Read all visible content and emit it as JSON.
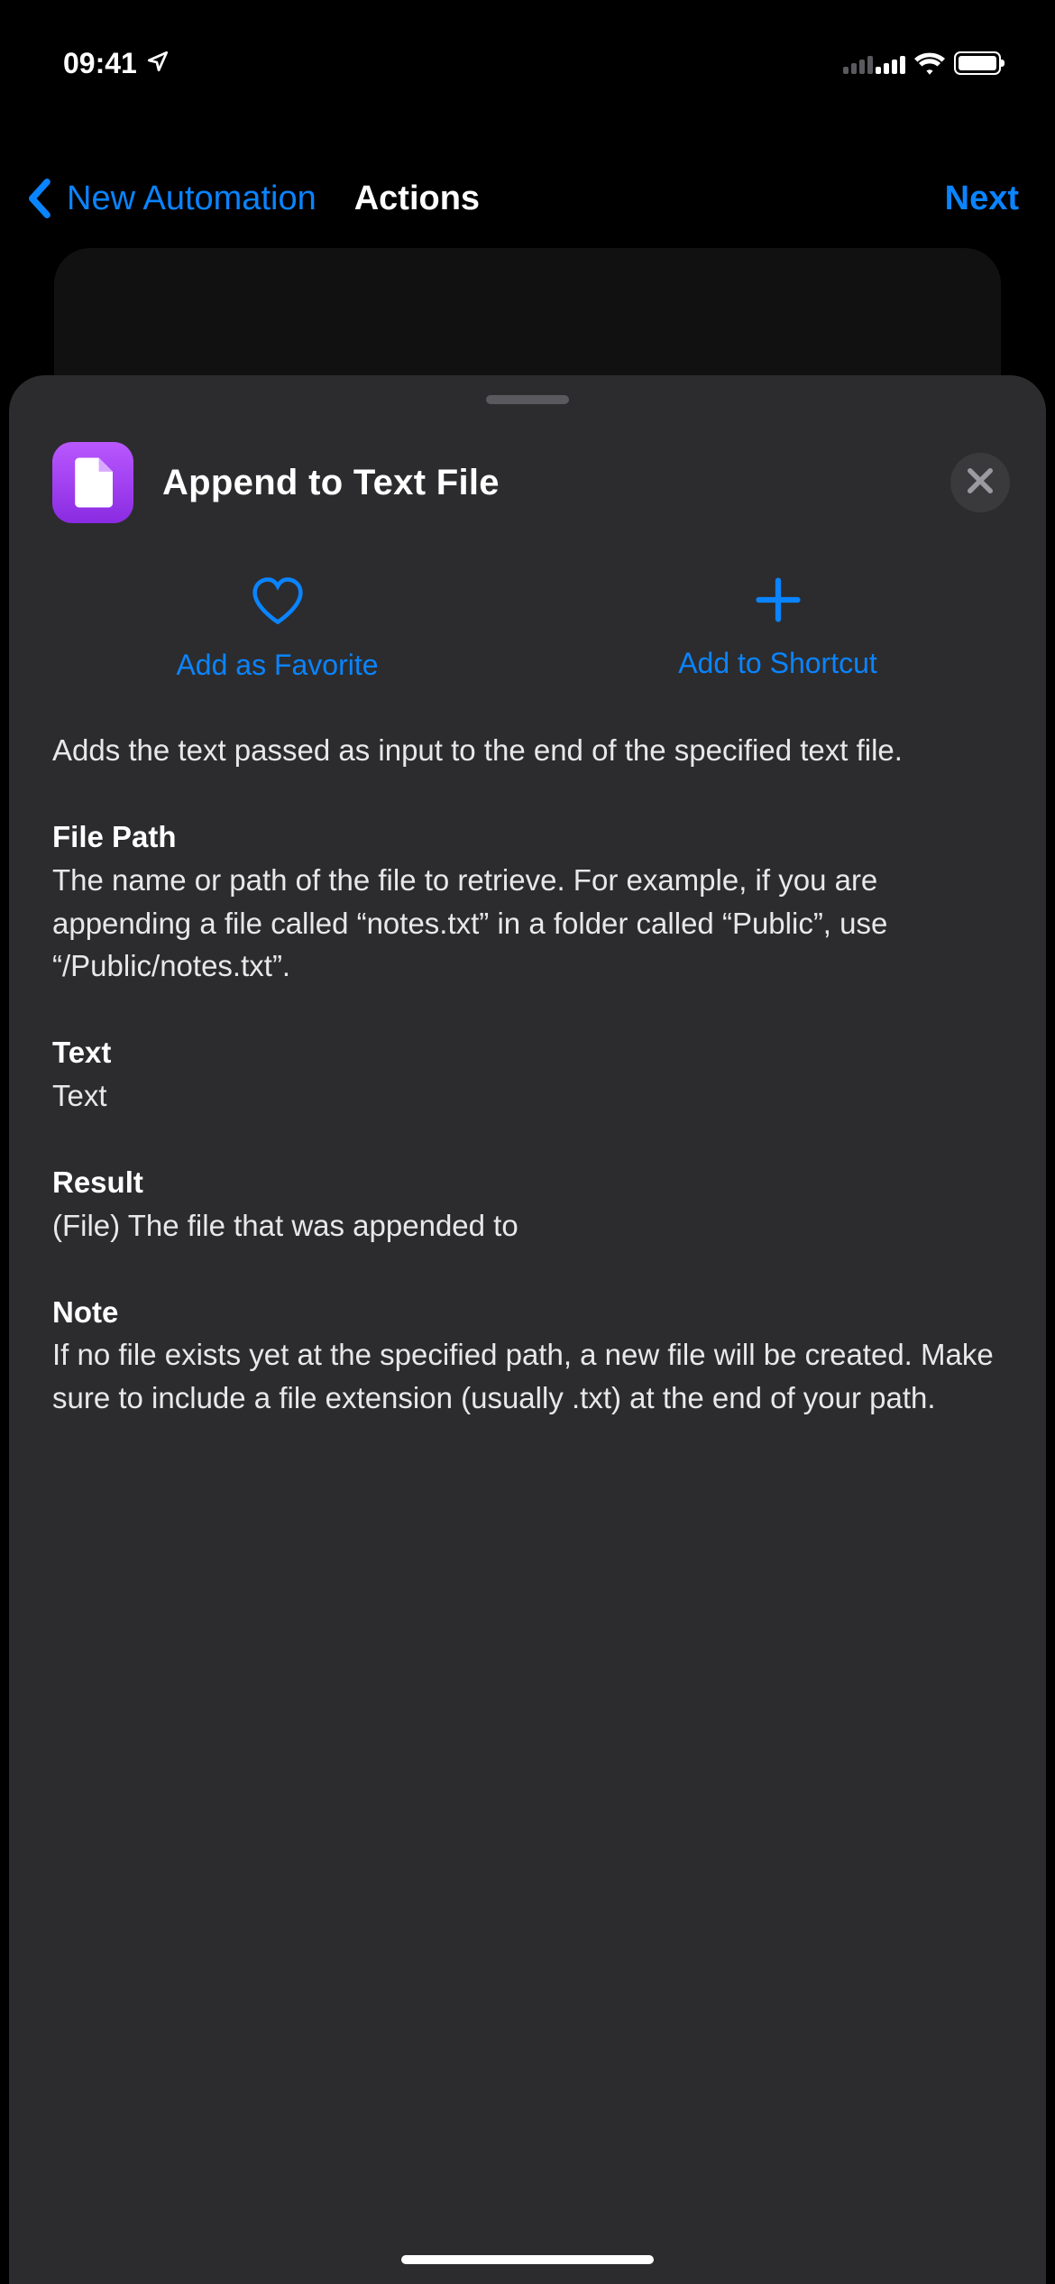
{
  "status": {
    "time": "09:41"
  },
  "nav": {
    "back_label": "New Automation",
    "title": "Actions",
    "next_label": "Next"
  },
  "sheet": {
    "title": "Append to Text File",
    "favorite_label": "Add as Favorite",
    "shortcut_label": "Add to Shortcut",
    "description": "Adds the text passed as input to the end of the specified text file.",
    "sections": {
      "file_path": {
        "label": "File Path",
        "body": "The name or path of the file to retrieve. For example, if you are appending a file called “notes.txt” in a folder called “Public”, use “/Public/notes.txt”."
      },
      "text": {
        "label": "Text",
        "body": "Text"
      },
      "result": {
        "label": "Result",
        "body": "(File) The file that was appended to"
      },
      "note": {
        "label": "Note",
        "body": "If no file exists yet at the specified path, a new file will be created. Make sure to include a file extension (usually .txt) at the end of your path."
      }
    }
  }
}
